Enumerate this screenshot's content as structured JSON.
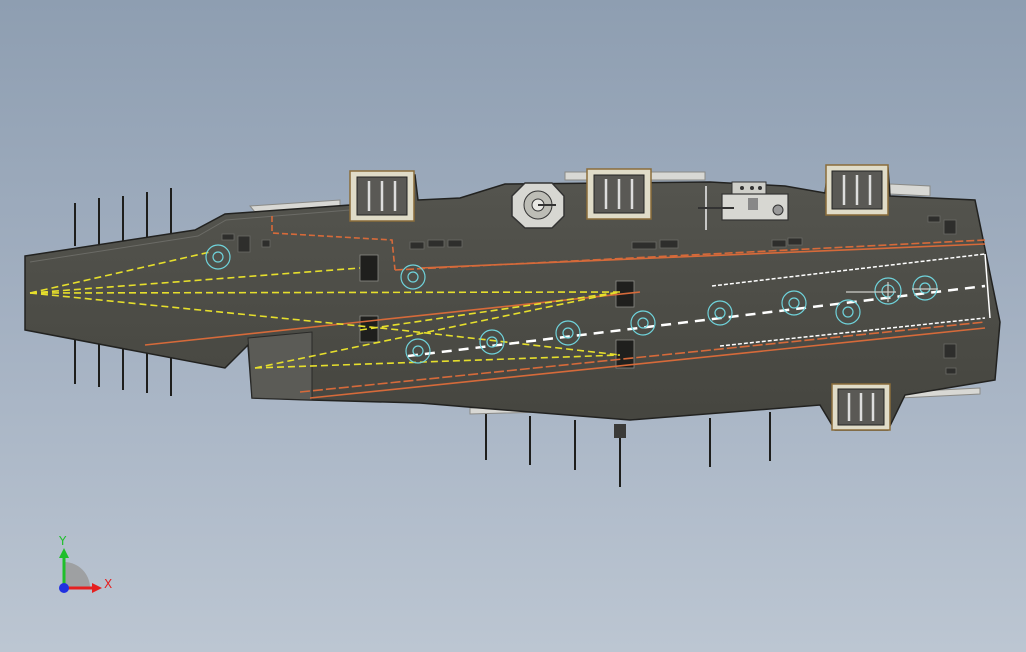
{
  "viewport": {
    "background_top": "#8e9eb1",
    "background_bottom": "#bcc6d2"
  },
  "model": {
    "hull_color": "#4b4b48",
    "deck_line_color": "#d66a3a",
    "deck_marking_color": "#e6df2c",
    "centerline_color": "#ffffff",
    "pad_ring_color": "#6fd3db"
  },
  "triad": {
    "x_label": "X",
    "y_label": "Y",
    "x_color": "#e52020",
    "y_color": "#1fbf2b",
    "origin_color": "#2030e0"
  }
}
